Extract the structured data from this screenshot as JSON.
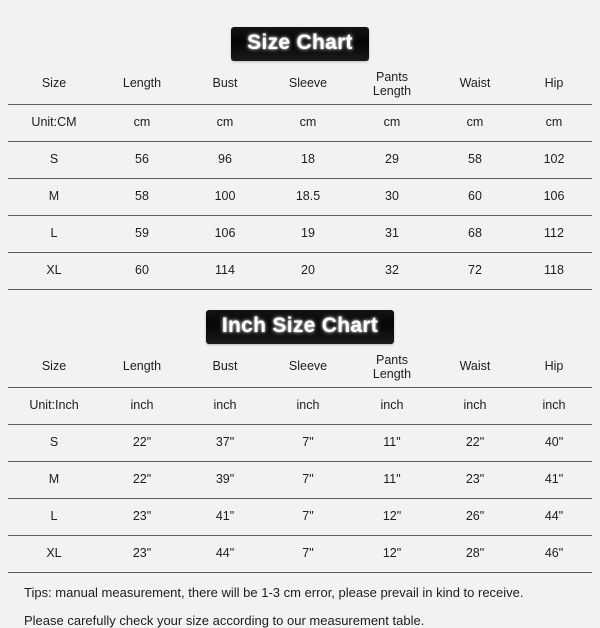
{
  "page": {
    "background_color": "#f2f2f2",
    "text_color": "#1d1d1d",
    "rule_color": "#5d5d5d",
    "banner_background": "#0b0b0b",
    "banner_text_color": "#ffffff"
  },
  "cm_chart": {
    "title": "Size Chart",
    "columns": [
      "Size",
      "Length",
      "Bust",
      "Sleeve",
      "Pants Length",
      "Waist",
      "Hip"
    ],
    "pants_length_line1": "Pants",
    "pants_length_line2": "Length",
    "unit_row": [
      "Unit:CM",
      "cm",
      "cm",
      "cm",
      "cm",
      "cm",
      "cm"
    ],
    "rows": [
      [
        "S",
        "56",
        "96",
        "18",
        "29",
        "58",
        "102"
      ],
      [
        "M",
        "58",
        "100",
        "18.5",
        "30",
        "60",
        "106"
      ],
      [
        "L",
        "59",
        "106",
        "19",
        "31",
        "68",
        "112"
      ],
      [
        "XL",
        "60",
        "114",
        "20",
        "32",
        "72",
        "118"
      ]
    ]
  },
  "inch_chart": {
    "title": "Inch Size Chart",
    "columns": [
      "Size",
      "Length",
      "Bust",
      "Sleeve",
      "Pants Length",
      "Waist",
      "Hip"
    ],
    "pants_length_line1": "Pants",
    "pants_length_line2": "Length",
    "unit_row": [
      "Unit:Inch",
      "inch",
      "inch",
      "inch",
      "inch",
      "inch",
      "inch"
    ],
    "rows": [
      [
        "S",
        "22\"",
        "37\"",
        "7\"",
        "11\"",
        "22\"",
        "40\""
      ],
      [
        "M",
        "22\"",
        "39\"",
        "7\"",
        "11\"",
        "23\"",
        "41\""
      ],
      [
        "L",
        "23\"",
        "41\"",
        "7\"",
        "12\"",
        "26\"",
        "44\""
      ],
      [
        "XL",
        "23\"",
        "44\"",
        "7\"",
        "12\"",
        "28\"",
        "46\""
      ]
    ]
  },
  "footer": {
    "line1": "Tips: manual measurement, there will be 1-3 cm error, please prevail in kind to receive.",
    "line2": "Please carefully check your size according to our measurement table."
  }
}
